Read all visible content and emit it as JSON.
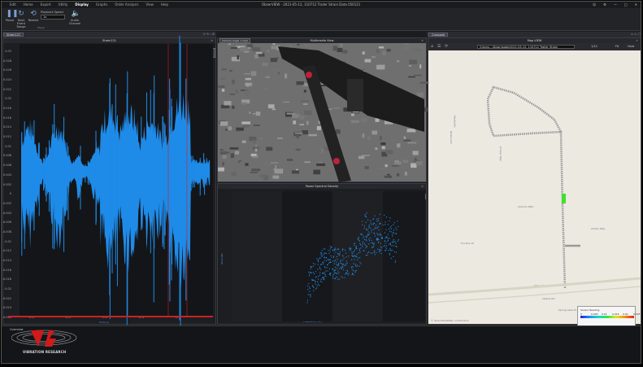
{
  "titlebar": {
    "menus": [
      "Edit",
      "Home",
      "Export",
      "Utility",
      "Display",
      "Graphs",
      "Order Analysis",
      "View",
      "Help"
    ],
    "active_menu": "Display",
    "title": "ObserVIEW - 2021-05-12, 110712 Trailer Strain Data 050121",
    "window_controls": [
      "☺",
      "⚙",
      "—",
      "□",
      "✕"
    ]
  },
  "ribbon": {
    "buttons": [
      {
        "label": "Pause",
        "icon": "pause-icon",
        "glyph": "❚❚"
      },
      {
        "label": "Next Event Range",
        "icon": "next-event-icon",
        "glyph": "↻"
      },
      {
        "label": "Rewind",
        "icon": "rewind-icon",
        "glyph": "⟲"
      },
      {
        "label": "Audio Channel",
        "icon": "audio-icon",
        "glyph": "🔈"
      }
    ],
    "speed_label": "Playback Speed",
    "speed_value": "1x",
    "group_label": "Player"
  },
  "left_tabstrip": {
    "tab": "Strain121",
    "tools": "⚲ ⟲ ⌕ ⚙"
  },
  "right_tabstrip": {
    "tab": "Crossplot",
    "tools": "▭ ▭ ▢"
  },
  "strain_panel": {
    "title": "Strain121",
    "legend": "CH1 S/T Strain 1pcs",
    "yticks": [
      "0.03",
      "0.028",
      "0.026",
      "0.024",
      "0.022",
      "0.02",
      "0.018",
      "0.016",
      "0.014",
      "0.012",
      "0.01",
      "0.008",
      "0.006",
      "0.004",
      "0.002",
      "0",
      "-0.002",
      "-0.004",
      "-0.006",
      "-0.008",
      "-0.01",
      "-0.012",
      "-0.014",
      "-0.016",
      "-0.018",
      "-0.02",
      "-0.022",
      "-0.024",
      "-0.026"
    ],
    "xticks": [
      "172",
      "173",
      "174",
      "175",
      "176"
    ],
    "xlabel": "Time (s)",
    "color": "#1f8be8"
  },
  "video_panel": {
    "title": "Multimedia View",
    "tab": "Camera Angle 1.mp4"
  },
  "psd_panel": {
    "title": "Power Spectral Density",
    "legend": "CH1 S/T Strain 1pcs",
    "yticks": [
      "1E-07",
      "1E-08",
      "1E-09"
    ],
    "xticks": [
      "1",
      "10",
      "100",
      "1000"
    ],
    "xlabel": "Frequency (Hz)",
    "ylabel": "Strain/Hz"
  },
  "map_panel": {
    "title": "Map VIEW",
    "path": "\\Users\\...\\Downloads\\2021-05-12, 110712 Trailer Strain",
    "controls": [
      "1/12",
      "Fit",
      "Hold"
    ],
    "roads": [
      "Valley Rd",
      "Liberty Rd",
      "Amber Way",
      "Juniper Way",
      "Hickory Dr",
      "Autumn Path",
      "Fox Run Dr",
      "Spring Lake Dr",
      "Alaska Rd"
    ],
    "attribution": "© OpenStreetMap contributors"
  },
  "colorbar": {
    "title": "Sensor Reading",
    "ticks": [
      "0",
      "0.005",
      "0.01",
      "0.015",
      "0.02",
      "0.025"
    ]
  },
  "overview": {
    "label": "Overview",
    "logo_text": "VIBRATION RESEARCH"
  }
}
